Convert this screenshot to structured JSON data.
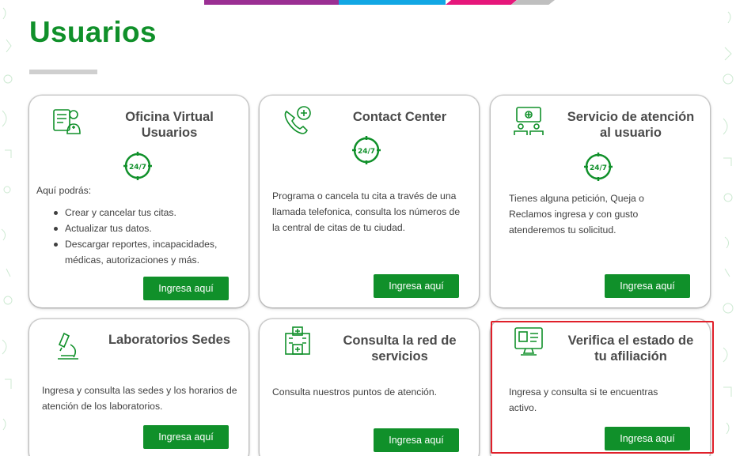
{
  "page": {
    "title": "Usuarios"
  },
  "colors": {
    "brand_green": "#10902a",
    "highlight_red": "#e0202a"
  },
  "badge_text": "24/7",
  "cards": [
    {
      "title": "Oficina Virtual Usuarios",
      "icon": "virtual-office-doctor-icon",
      "badge": true,
      "intro": "Aquí podrás:",
      "bullets": [
        "Crear y cancelar tus citas.",
        "Actualizar tus datos.",
        "Descargar reportes, incapacidades, médicas, autorizaciones y más."
      ],
      "button": "Ingresa aquí"
    },
    {
      "title": "Contact Center",
      "icon": "phone-medical-icon",
      "badge": true,
      "text": "Programa o cancela tu cita a través de una llamada telefonica, consulta los números de la central de citas de tu ciudad.",
      "button": "Ingresa aquí"
    },
    {
      "title": "Servicio de atención al usuario",
      "icon": "service-desk-icon",
      "badge": true,
      "text": "Tienes alguna petición, Queja o Reclamos ingresa y con gusto atenderemos tu solicitud.",
      "button": "Ingresa aquí"
    },
    {
      "title": "Laboratorios Sedes",
      "icon": "microscope-icon",
      "badge": false,
      "text": "Ingresa y consulta las sedes y los horarios de atención de los laboratorios.",
      "button": "Ingresa aquí"
    },
    {
      "title": "Consulta la red de servicios",
      "icon": "hospital-icon",
      "badge": false,
      "text": "Consulta nuestros puntos de atención.",
      "button": "Ingresa aquí"
    },
    {
      "title": "Verifica el estado de tu afiliación",
      "icon": "id-card-monitor-icon",
      "badge": false,
      "text": "Ingresa y consulta si te encuentras activo.",
      "button": "Ingresa aquí",
      "highlighted": true
    }
  ]
}
